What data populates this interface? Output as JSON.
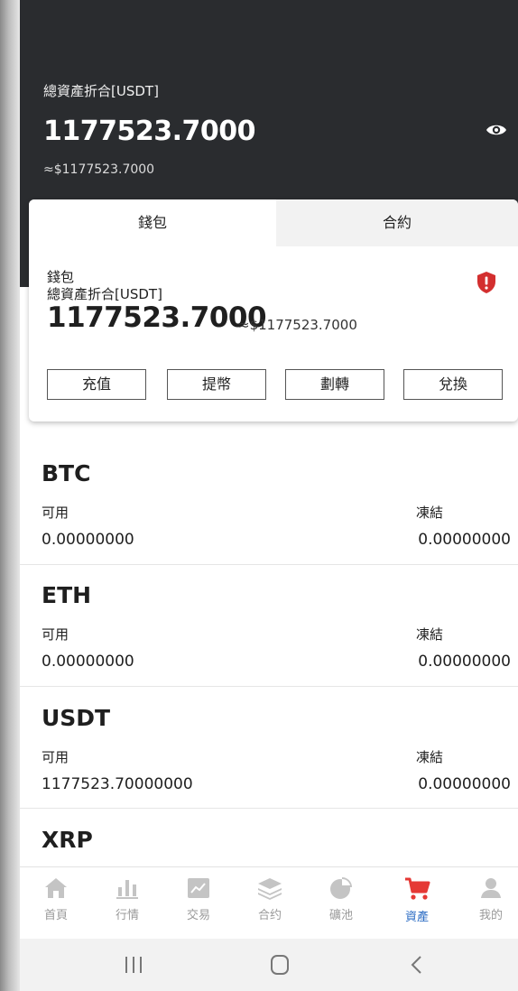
{
  "header": {
    "total_label": "總資產折合[USDT]",
    "total_amount": "1177523.7000",
    "total_approx": "≈$1177523.7000"
  },
  "card": {
    "tabs": [
      "錢包",
      "合約"
    ],
    "wallet_label": "錢包",
    "total_label": "總資產折合[USDT]",
    "amount": "1177523.7000",
    "approx": "≈$1177523.7000",
    "buttons": [
      "充值",
      "提幣",
      "劃轉",
      "兌換"
    ]
  },
  "coins": [
    {
      "name": "BTC",
      "available_label": "可用",
      "available": "0.00000000",
      "frozen_label": "凍結",
      "frozen": "0.00000000"
    },
    {
      "name": "ETH",
      "available_label": "可用",
      "available": "0.00000000",
      "frozen_label": "凍結",
      "frozen": "0.00000000"
    },
    {
      "name": "USDT",
      "available_label": "可用",
      "available": "1177523.70000000",
      "frozen_label": "凍結",
      "frozen": "0.00000000"
    },
    {
      "name": "XRP"
    }
  ],
  "nav": [
    {
      "label": "首頁",
      "icon": "home-icon"
    },
    {
      "label": "行情",
      "icon": "market-icon"
    },
    {
      "label": "交易",
      "icon": "trade-icon"
    },
    {
      "label": "合约",
      "icon": "contract-icon"
    },
    {
      "label": "礦池",
      "icon": "pool-icon"
    },
    {
      "label": "資產",
      "icon": "cart-icon",
      "active": true
    },
    {
      "label": "我的",
      "icon": "user-icon"
    }
  ],
  "colors": {
    "header_bg": "#2a2c2f",
    "active_nav": "#2b6cc4",
    "cart_red": "#e53935",
    "shield_red": "#d32f2f"
  }
}
